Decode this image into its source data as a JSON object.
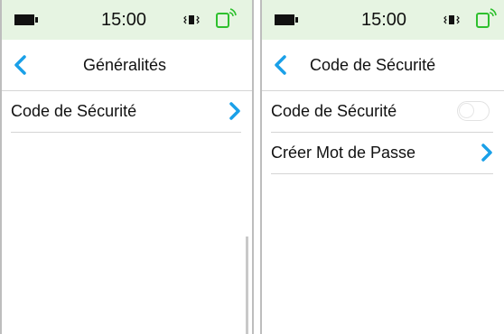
{
  "colors": {
    "status_bar_bg": "#e6f4e2",
    "accent": "#1aa0e8",
    "battery_icon_green": "#2ec02e"
  },
  "screens": [
    {
      "status_bar": {
        "time": "15:00",
        "icons": [
          "battery-icon",
          "vibrate-icon",
          "phone-battery-icon"
        ]
      },
      "nav": {
        "back_icon": "chevron-left-icon",
        "title": "Généralités"
      },
      "items": [
        {
          "label": "Code de Sécurité",
          "control": "chevron-right-icon"
        }
      ]
    },
    {
      "status_bar": {
        "time": "15:00",
        "icons": [
          "battery-icon",
          "vibrate-icon",
          "phone-battery-icon"
        ]
      },
      "nav": {
        "back_icon": "chevron-left-icon",
        "title": "Code de Sécurité"
      },
      "items": [
        {
          "label": "Code de Sécurité",
          "control": "toggle-switch",
          "toggle_on": false
        },
        {
          "label": "Créer Mot de Passe",
          "control": "chevron-right-icon"
        }
      ]
    }
  ]
}
